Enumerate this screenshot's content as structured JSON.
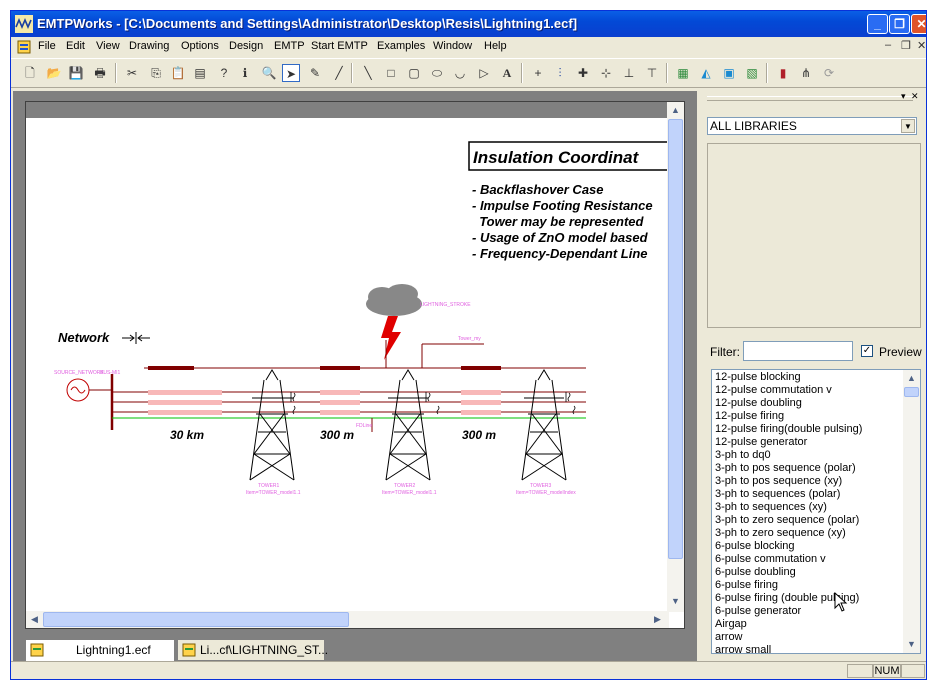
{
  "window": {
    "title": "EMTPWorks - [C:\\Documents and Settings\\Administrator\\Desktop\\Resis\\Lightning1.ecf]"
  },
  "menu": {
    "items": [
      "File",
      "Edit",
      "View",
      "Drawing",
      "Options",
      "Design",
      "EMTP",
      "Start EMTP",
      "Examples",
      "Window",
      "Help"
    ]
  },
  "canvas": {
    "title": "Insulation Coordinat",
    "bullets": [
      "- Backflashover Case",
      "- Impulse Footing Resistance",
      "  Tower may be represented",
      "- Usage of ZnO model based",
      "- Frequency-Dependant Line"
    ],
    "network_label": "Network",
    "dist_30km": "30 km",
    "dist_300m_1": "300 m",
    "dist_300m_2": "300 m",
    "lightning_label": "LIGHTNING_STROKE",
    "source_label": "SOURCE_NETWORK",
    "bus_label": "BUS-MI1",
    "tower_my_label": "Tower_my",
    "tower1_label": "TOWER1",
    "tower1_sub": "Item=TOWER_model1.1",
    "tower2_label": "TOWER2",
    "tower2_sub": "Item=TOWER_model1.1",
    "tower3_label": "TOWER3",
    "tower3_sub": "Item=TOWER_modelIndex",
    "fdline_label": "FDLine"
  },
  "tabs": [
    "Lightning1.ecf",
    "Li...cf\\LIGHTNING_ST..."
  ],
  "library": {
    "selected": "ALL LIBRARIES",
    "filter_label": "Filter:",
    "filter_value": "",
    "preview_label": "Preview",
    "items": [
      "12-pulse blocking",
      "12-pulse commutation v",
      "12-pulse doubling",
      "12-pulse firing",
      "12-pulse firing(double pulsing)",
      "12-pulse generator",
      "3-ph to dq0",
      "3-ph to pos sequence (polar)",
      "3-ph to pos sequence (xy)",
      "3-ph to sequences (polar)",
      "3-ph to sequences (xy)",
      "3-ph to zero sequence (polar)",
      "3-ph to zero sequence (xy)",
      "6-pulse blocking",
      "6-pulse commutation v",
      "6-pulse doubling",
      "6-pulse firing",
      "6-pulse firing (double pulsing)",
      "6-pulse generator",
      "Airgap",
      "arrow",
      "arrow small"
    ]
  },
  "status": {
    "num": "NUM"
  }
}
